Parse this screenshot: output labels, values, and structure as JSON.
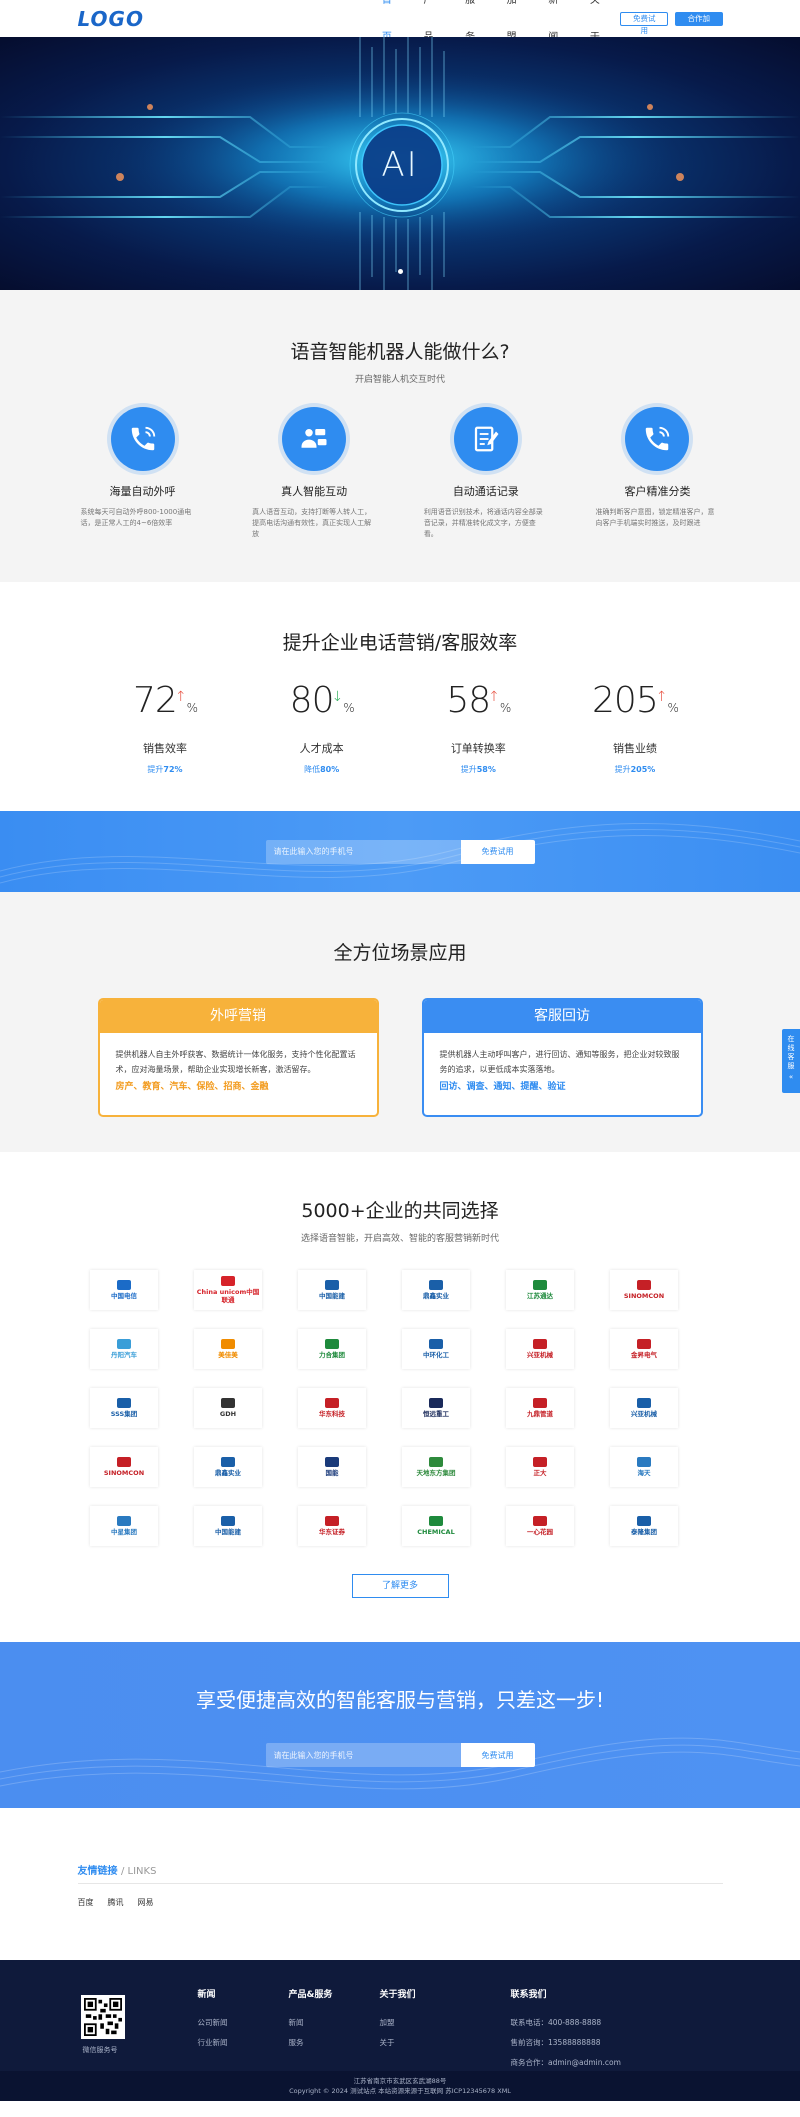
{
  "header": {
    "logo": "LOGO",
    "nav": [
      "首页",
      "产品",
      "服务",
      "加盟",
      "新闻",
      "关于"
    ],
    "trial_button": "免费试用",
    "join_button": "合作加盟"
  },
  "banner": {
    "center_text": "AI"
  },
  "abilities": {
    "title": "语音智能机器人能做什么?",
    "subtitle": "开启智能人机交互时代",
    "items": [
      {
        "title": "海量自动外呼",
        "desc": "系统每天可自动外呼800-1000通电话，是正常人工的4~6倍效率",
        "icon": "phone-icon"
      },
      {
        "title": "真人智能互动",
        "desc": "真人语音互动，支持打断等人转人工，提高电话沟通有效性，真正实现人工解放",
        "icon": "users-icon"
      },
      {
        "title": "自动通话记录",
        "desc": "利用语音识别技术，将通话内容全部录音记录，并精准转化成文字，方便查看。",
        "icon": "notepad-icon"
      },
      {
        "title": "客户精准分类",
        "desc": "准确判断客户意图，锁定精准客户，意向客户手机端实时推送，及时跟进",
        "icon": "phone-icon"
      }
    ]
  },
  "stats": {
    "title": "提升企业电话营销/客服效率",
    "items": [
      {
        "num": "72",
        "unit": "%",
        "arrow": "↑",
        "label": "销售效率",
        "sub_prefix": "提升",
        "sub_value": "72%"
      },
      {
        "num": "80",
        "unit": "%",
        "arrow": "↓",
        "label": "人才成本",
        "sub_prefix": "降低",
        "sub_value": "80%"
      },
      {
        "num": "58",
        "unit": "%",
        "arrow": "↑",
        "label": "订单转换率",
        "sub_prefix": "提升",
        "sub_value": "58%"
      },
      {
        "num": "205",
        "unit": "%",
        "arrow": "↑",
        "label": "销售业绩",
        "sub_prefix": "提升",
        "sub_value": "205%"
      }
    ]
  },
  "cta1": {
    "placeholder": "请在此输入您的手机号",
    "button": "免费试用"
  },
  "scenes": {
    "title": "全方位场景应用",
    "cards": [
      {
        "title": "外呼营销",
        "desc": "提供机器人自主外呼获客、数据统计一体化服务，支持个性化配置话术，应对海量场景，帮助企业实现增长新客，激活留存。",
        "tags": "房产、教育、汽车、保险、招商、金融"
      },
      {
        "title": "客服回访",
        "desc": "提供机器人主动呼叫客户，进行回访、通知等服务，把企业对较致服务的追求，以更低成本实落落地。",
        "tags": "回访、调查、通知、提醒、验证"
      }
    ]
  },
  "clients": {
    "title": "5000+企业的共同选择",
    "subtitle": "选择语音智能，开启高效、智能的客服营销新时代",
    "logos": [
      {
        "name": "中国电信",
        "color": "#1b6bc7"
      },
      {
        "name": "China unicom中国联通",
        "color": "#d6232a"
      },
      {
        "name": "中国能建",
        "color": "#1a5fa8"
      },
      {
        "name": "鼎鑫实业",
        "color": "#1a5fa8"
      },
      {
        "name": "江苏通达",
        "color": "#1e8a3c"
      },
      {
        "name": "SINOMCON",
        "color": "#c52026"
      },
      {
        "name": "丹阳汽车",
        "color": "#3a9ed8"
      },
      {
        "name": "美佳美",
        "color": "#f08c00"
      },
      {
        "name": "力合集团",
        "color": "#1e8a3c"
      },
      {
        "name": "中环化工",
        "color": "#1a5fa8"
      },
      {
        "name": "兴亚机械",
        "color": "#c52026"
      },
      {
        "name": "金昇电气",
        "color": "#c52026"
      },
      {
        "name": "SSS集团",
        "color": "#1a5fa8"
      },
      {
        "name": "GDH",
        "color": "#333333"
      },
      {
        "name": "华东科技",
        "color": "#c52026"
      },
      {
        "name": "恒远重工",
        "color": "#1a2a5a"
      },
      {
        "name": "九鼎管道",
        "color": "#c52026"
      },
      {
        "name": "兴亚机械",
        "color": "#1a5fa8"
      },
      {
        "name": "SINOMCON",
        "color": "#c52026"
      },
      {
        "name": "鼎鑫实业",
        "color": "#1a5fa8"
      },
      {
        "name": "国能",
        "color": "#1a3a7a"
      },
      {
        "name": "天地东方集团",
        "color": "#2e8a3c"
      },
      {
        "name": "正大",
        "color": "#c52026"
      },
      {
        "name": "海天",
        "color": "#2a7ac0"
      },
      {
        "name": "中星集团",
        "color": "#2a7ac0"
      },
      {
        "name": "中国能建",
        "color": "#1a5fa8"
      },
      {
        "name": "华东证券",
        "color": "#c52026"
      },
      {
        "name": "CHEMICAL",
        "color": "#1e8a3c"
      },
      {
        "name": "一心花园",
        "color": "#c52026"
      },
      {
        "name": "泰隆集团",
        "color": "#1a5fa8"
      }
    ],
    "more": "了解更多"
  },
  "cta2": {
    "title": "享受便捷高效的智能客服与营销，只差这一步!",
    "placeholder": "请在此输入您的手机号",
    "button": "免费试用"
  },
  "links": {
    "title": "友情链接",
    "title_en": "/ LINKS",
    "items": [
      "百度",
      "腾讯",
      "网易"
    ]
  },
  "footer": {
    "qr_caption": "微信服务号",
    "cols": [
      {
        "title": "新闻",
        "items": [
          "公司新闻",
          "行业新闻"
        ]
      },
      {
        "title": "产品&服务",
        "items": [
          "新闻",
          "服务"
        ]
      },
      {
        "title": "关于我们",
        "items": [
          "加盟",
          "关于"
        ]
      }
    ],
    "contact": {
      "title": "联系我们",
      "lines": [
        "联系电话：400-888-8888",
        "售前咨询：13588888888",
        "商务合作：admin@admin.com"
      ]
    },
    "address": "江苏省南京市玄武区玄武湖88号",
    "copyright": "Copyright © 2024 测试站点 本站资源来源于互联网 苏ICP12345678  XML"
  },
  "sidetab": "在线客服"
}
